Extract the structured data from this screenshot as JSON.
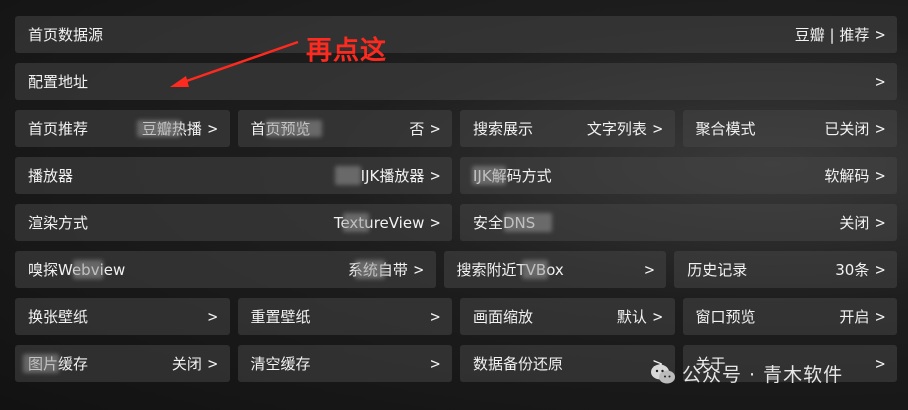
{
  "annotation": {
    "text": "再点这"
  },
  "rows": [
    [
      {
        "label": "首页数据源",
        "value": "豆瓣 | 推荐",
        "chevron": ">"
      }
    ],
    [
      {
        "label": "配置地址",
        "value": "",
        "chevron": ">"
      }
    ],
    [
      {
        "label": "首页推荐",
        "value": "豆瓣热播",
        "chevron": ">"
      },
      {
        "label": "首页预览",
        "value": "否",
        "chevron": ">"
      },
      {
        "label": "搜索展示",
        "value": "文字列表",
        "chevron": ">"
      },
      {
        "label": "聚合模式",
        "value": "已关闭",
        "chevron": ">"
      }
    ],
    [
      {
        "label": "播放器",
        "value": "IJK播放器",
        "chevron": ">"
      },
      {
        "label": "IJK解码方式",
        "value": "软解码",
        "chevron": ">"
      }
    ],
    [
      {
        "label": "渲染方式",
        "value": "TextureView",
        "chevron": ">"
      },
      {
        "label": "安全DNS",
        "value": "关闭",
        "chevron": ">"
      }
    ],
    [
      {
        "label": "嗅探Webview",
        "value": "系统自带",
        "chevron": ">"
      },
      {
        "label": "搜索附近TVBox",
        "value": "",
        "chevron": ">"
      },
      {
        "label": "历史记录",
        "value": "30条",
        "chevron": ">"
      }
    ],
    [
      {
        "label": "换张壁纸",
        "value": "",
        "chevron": ">"
      },
      {
        "label": "重置壁纸",
        "value": "",
        "chevron": ">"
      },
      {
        "label": "画面缩放",
        "value": "默认",
        "chevron": ">"
      },
      {
        "label": "窗口预览",
        "value": "开启",
        "chevron": ">"
      }
    ],
    [
      {
        "label": "图片缓存",
        "value": "关闭",
        "chevron": ">"
      },
      {
        "label": "清空缓存",
        "value": "",
        "chevron": ">"
      },
      {
        "label": "数据备份还原",
        "value": "",
        "chevron": ">"
      },
      {
        "label": "关于",
        "value": "",
        "chevron": ">"
      }
    ]
  ],
  "watermark": {
    "text": "公众号 · 青木软件"
  }
}
